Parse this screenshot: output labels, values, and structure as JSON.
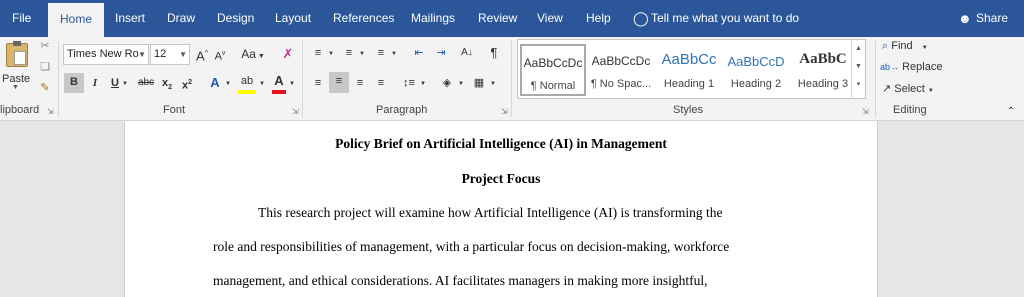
{
  "menu": {
    "file": "File",
    "home": "Home",
    "insert": "Insert",
    "draw": "Draw",
    "design": "Design",
    "layout": "Layout",
    "references": "References",
    "mailings": "Mailings",
    "review": "Review",
    "view": "View",
    "help": "Help",
    "tell_me": "Tell me what you want to do",
    "share": "Share"
  },
  "ribbon": {
    "clipboard": {
      "paste_label": "Paste",
      "group_label": "lipboard"
    },
    "font": {
      "family": "Times New Ro",
      "size": "12",
      "group_label": "Font",
      "grow": "A",
      "shrink": "A",
      "case": "Aa",
      "bold": "B",
      "italic": "I",
      "underline": "U",
      "strike": "abc",
      "subscript": "x",
      "superscript": "x",
      "text_effects": "A",
      "highlight": "ab",
      "font_color": "A"
    },
    "paragraph": {
      "group_label": "Paragraph",
      "pilcrow": "¶"
    },
    "styles": {
      "group_label": "Styles",
      "items": [
        {
          "sample": "AaBbCcDc",
          "name": "¶ Normal"
        },
        {
          "sample": "AaBbCcDc",
          "name": "¶ No Spac..."
        },
        {
          "sample": "AaBbCc",
          "name": "Heading 1"
        },
        {
          "sample": "AaBbCcD",
          "name": "Heading 2"
        },
        {
          "sample": "AaBbC",
          "name": "Heading 3"
        }
      ]
    },
    "editing": {
      "find": "Find",
      "replace": "Replace",
      "select": "Select",
      "group_label": "Editing"
    }
  },
  "document": {
    "title": "Policy Brief on Artificial Intelligence (AI) in Management",
    "heading": "Project Focus",
    "lines": [
      "This research project will examine how Artificial Intelligence (AI) is transforming the",
      "role and responsibilities of management, with a particular focus on decision-making, workforce",
      "management, and ethical considerations. AI facilitates managers in making more insightful,"
    ]
  },
  "colors": {
    "brand": "#2b579a",
    "ribbon": "#f3f3f3",
    "highlight": "#ffff00",
    "font_color": "#e81123"
  }
}
